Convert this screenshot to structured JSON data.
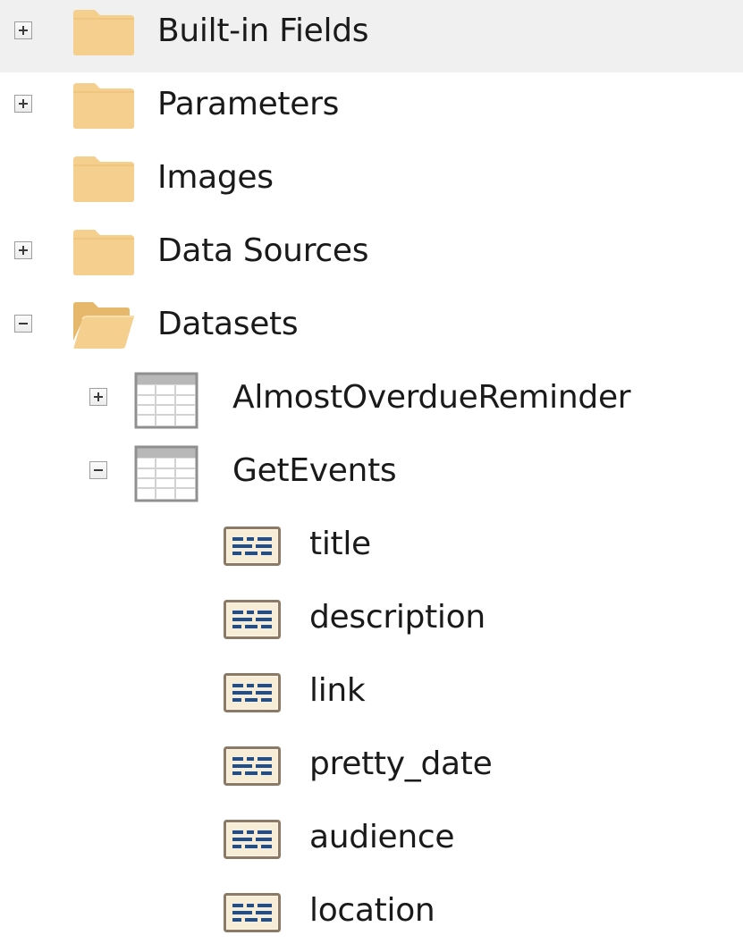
{
  "tree": {
    "items": [
      {
        "label": "Built-in Fields",
        "toggle": "expand",
        "icon": "folder-icon",
        "level": 0,
        "selected": true
      },
      {
        "label": "Parameters",
        "toggle": "expand",
        "icon": "folder-icon",
        "level": 0
      },
      {
        "label": "Images",
        "toggle": "none",
        "icon": "folder-icon",
        "level": 0
      },
      {
        "label": "Data Sources",
        "toggle": "expand",
        "icon": "folder-icon",
        "level": 0
      },
      {
        "label": "Datasets",
        "toggle": "collapse",
        "icon": "folder-open-icon",
        "level": 0
      },
      {
        "label": "AlmostOverdueReminder",
        "toggle": "expand",
        "icon": "table-icon",
        "level": 1
      },
      {
        "label": "GetEvents",
        "toggle": "collapse",
        "icon": "table-icon",
        "level": 1
      },
      {
        "label": "title",
        "toggle": "none",
        "icon": "field-icon",
        "level": 2
      },
      {
        "label": "description",
        "toggle": "none",
        "icon": "field-icon",
        "level": 2
      },
      {
        "label": "link",
        "toggle": "none",
        "icon": "field-icon",
        "level": 2
      },
      {
        "label": "pretty_date",
        "toggle": "none",
        "icon": "field-icon",
        "level": 2
      },
      {
        "label": "audience",
        "toggle": "none",
        "icon": "field-icon",
        "level": 2
      },
      {
        "label": "location",
        "toggle": "none",
        "icon": "field-icon",
        "level": 2
      }
    ]
  },
  "colors": {
    "folder": "#f5cf8e",
    "selection": "#f0f0f0",
    "text": "#1a1a1a"
  }
}
